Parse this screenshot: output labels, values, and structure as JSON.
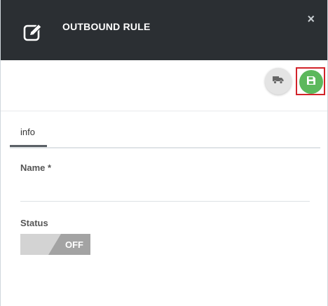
{
  "header": {
    "title": "OUTBOUND RULE",
    "close_label": "×"
  },
  "toolbar": {
    "deploy_icon": "truck-icon",
    "save_icon": "floppy-disk-icon",
    "save_color": "#5cb85c",
    "highlight_color": "#d2232a"
  },
  "tabs": [
    {
      "label": "info",
      "active": true
    }
  ],
  "form": {
    "name_label": "Name *",
    "name_value": "",
    "status_label": "Status",
    "status_toggle": {
      "label": "OFF",
      "checked": false
    }
  }
}
